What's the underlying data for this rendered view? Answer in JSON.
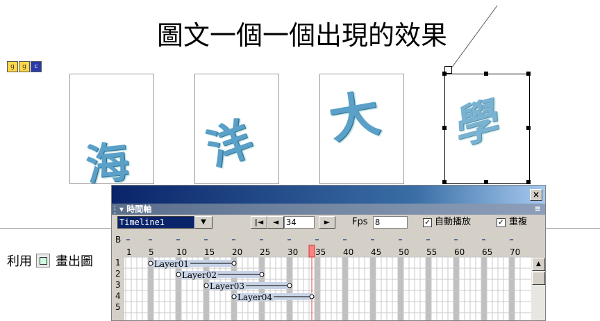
{
  "slide": {
    "title": "圖文一個一個出現的效果",
    "cards": [
      "海",
      "洋",
      "大",
      "學"
    ]
  },
  "body_text": {
    "prefix": "利用",
    "suffix": "畫出圖"
  },
  "timeline_window": {
    "close_label": "×",
    "panel_title": "時間軸",
    "panel_menu": "≡",
    "timeline_name": "Timeline1",
    "dropdown_arrow": "▼",
    "first_frame_btn": "|◄",
    "prev_frame_btn": "◄",
    "frame_value": "34",
    "next_frame_btn": "►",
    "fps_label": "Fps",
    "fps_value": "8",
    "autoplay_label": "自動播放",
    "autoplay_checked": true,
    "loop_label": "重複",
    "loop_checked": true,
    "checkmark": "✓",
    "behavior_row_label": "B",
    "ruler_ticks": [
      "1",
      "5",
      "10",
      "15",
      "20",
      "25",
      "30",
      "35",
      "40",
      "45",
      "50",
      "55",
      "60",
      "65",
      "70"
    ],
    "row_numbers": [
      "1",
      "2",
      "3",
      "4",
      "5"
    ],
    "layers": [
      {
        "name": "Layer01",
        "start": 5,
        "end": 20
      },
      {
        "name": "Layer02",
        "start": 10,
        "end": 25
      },
      {
        "name": "Layer03",
        "start": 15,
        "end": 30
      },
      {
        "name": "Layer04",
        "start": 20,
        "end": 34
      }
    ],
    "current_frame": 34,
    "scroll_up": "▲",
    "scroll_thumb": ""
  },
  "colors": {
    "accent_title": "#0a246a",
    "playhead": "#ff8080",
    "char_fill": "#5aa0c8"
  }
}
